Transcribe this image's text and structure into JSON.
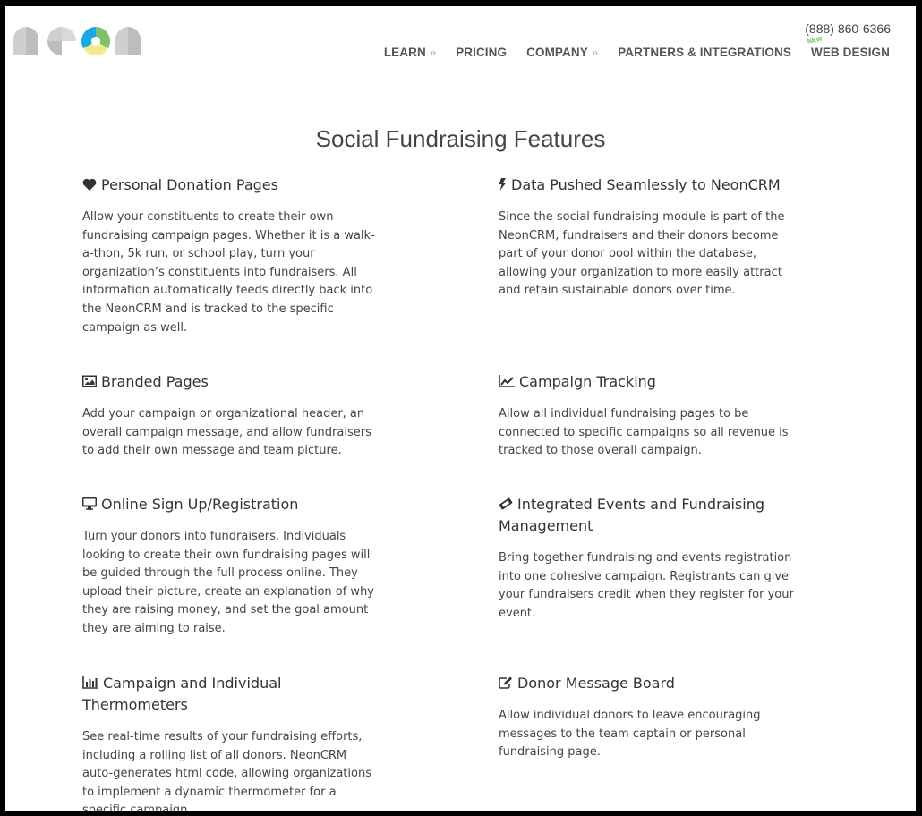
{
  "header": {
    "logo_alt": "neon",
    "phone": "(888) 860-6366",
    "nav": [
      {
        "label": "LEARN",
        "has_submenu": true,
        "chevron": "»"
      },
      {
        "label": "PRICING",
        "has_submenu": false
      },
      {
        "label": "COMPANY",
        "has_submenu": true,
        "chevron": "»"
      },
      {
        "label": "PARTNERS & INTEGRATIONS",
        "has_submenu": false
      },
      {
        "label": "WEB DESIGN",
        "has_submenu": false,
        "badge": "NEW"
      }
    ]
  },
  "main": {
    "title": "Social Fundraising Features",
    "features": [
      {
        "icon": "heart-icon",
        "title": "Personal Donation Pages",
        "text": "Allow your constituents to create their own fundraising campaign pages. Whether it is a walk-a-thon, 5k run, or school play, turn your organization’s constituents into fundraisers. All information automatically feeds directly back into the NeonCRM and is tracked to the specific campaign as well."
      },
      {
        "icon": "bolt-icon",
        "title": "Data Pushed Seamlessly to NeonCRM",
        "text": "Since the social fundraising module is part of the NeonCRM, fundraisers and their donors become part of your donor pool within the database, allowing your organization to more easily attract and retain sustainable donors over time."
      },
      {
        "icon": "picture-icon",
        "title": "Branded Pages",
        "text": "Add your campaign or organizational header, an overall campaign message, and allow fundraisers to add their own message and team picture."
      },
      {
        "icon": "line-chart-icon",
        "title": "Campaign Tracking",
        "text": "Allow all individual fundraising pages to be connected to specific campaigns so all revenue is tracked to those overall campaign."
      },
      {
        "icon": "desktop-icon",
        "title": "Online Sign Up/Registration",
        "text": "Turn your donors into fundraisers. Individuals looking to create their own fundraising pages will be guided through the full process online. They upload their picture, create an explanation of why they are raising money, and set the goal amount they are aiming to raise."
      },
      {
        "icon": "ticket-icon",
        "title": "Integrated Events and Fundraising Management",
        "text": "Bring together fundraising and events registration into one cohesive campaign. Registrants can give your fundraisers credit when they register for your event."
      },
      {
        "icon": "bar-chart-icon",
        "title": "Campaign and Individual Thermometers",
        "text": "See real-time results of your fundraising efforts, including a rolling list of all donors. NeonCRM auto-generates html code, allowing organizations to implement a dynamic thermometer for a specific campaign."
      },
      {
        "icon": "edit-icon",
        "title": "Donor Message Board",
        "text": "Allow individual donors to leave encouraging messages to the team captain or personal fundraising page."
      }
    ]
  },
  "colors": {
    "logo_blue": "#1aa7e8",
    "logo_green": "#7ac36a",
    "logo_yellow": "#f4ea8a",
    "logo_gray": "#c8c8c8",
    "new_badge": "#6cc04a",
    "nav_text": "#555555",
    "body_text": "#444444"
  }
}
